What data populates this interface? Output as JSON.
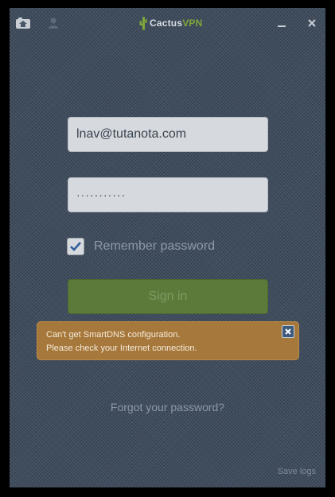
{
  "app": {
    "logo_part1": "Cactus",
    "logo_part2": "VPN",
    "icons": {
      "home": "home-icon",
      "user": "user-icon",
      "minimize": "minimize-icon",
      "close": "close-icon",
      "logo": "cactus-logo-icon",
      "checkbox": "check-icon",
      "toast_close": "close-icon"
    },
    "colors": {
      "background": "#475567",
      "accent_green": "#5c7a3a",
      "toast_orange": "#a7783b"
    }
  },
  "login": {
    "email_value": "lnav@tutanota.com",
    "password_value": "···········",
    "remember_label": "Remember password",
    "remember_checked": true,
    "signin_label": "Sign in",
    "forgot_label": "Forgot your password?"
  },
  "toast": {
    "line1": "Can't get SmartDNS configuration.",
    "line2": "Please check your Internet connection."
  },
  "footer": {
    "save_logs_label": "Save logs"
  }
}
